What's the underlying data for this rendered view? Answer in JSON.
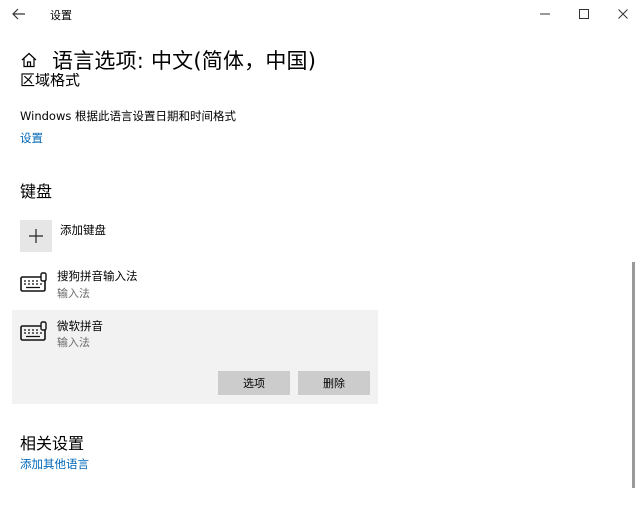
{
  "window": {
    "title": "设置",
    "minimize_icon": "minimize-icon",
    "maximize_icon": "maximize-icon",
    "close_icon": "close-icon"
  },
  "header": {
    "title": "语言选项: 中文(简体，中国)",
    "home_icon": "home-icon"
  },
  "region": {
    "heading": "区域格式",
    "description": "Windows 根据此语言设置日期和时间格式",
    "link": "设置"
  },
  "keyboard": {
    "heading": "键盘",
    "add_label": "添加键盘",
    "items": [
      {
        "name": "搜狗拼音输入法",
        "type": "输入法",
        "icon": "keyboard-icon"
      },
      {
        "name": "微软拼音",
        "type": "输入法",
        "icon": "keyboard-icon",
        "selected": true
      }
    ],
    "options_button": "选项",
    "remove_button": "删除"
  },
  "related": {
    "heading": "相关设置",
    "link": "添加其他语言"
  },
  "colors": {
    "link": "#0067b8",
    "button_bg": "#cccccc",
    "selected_bg": "#f2f2f2"
  }
}
